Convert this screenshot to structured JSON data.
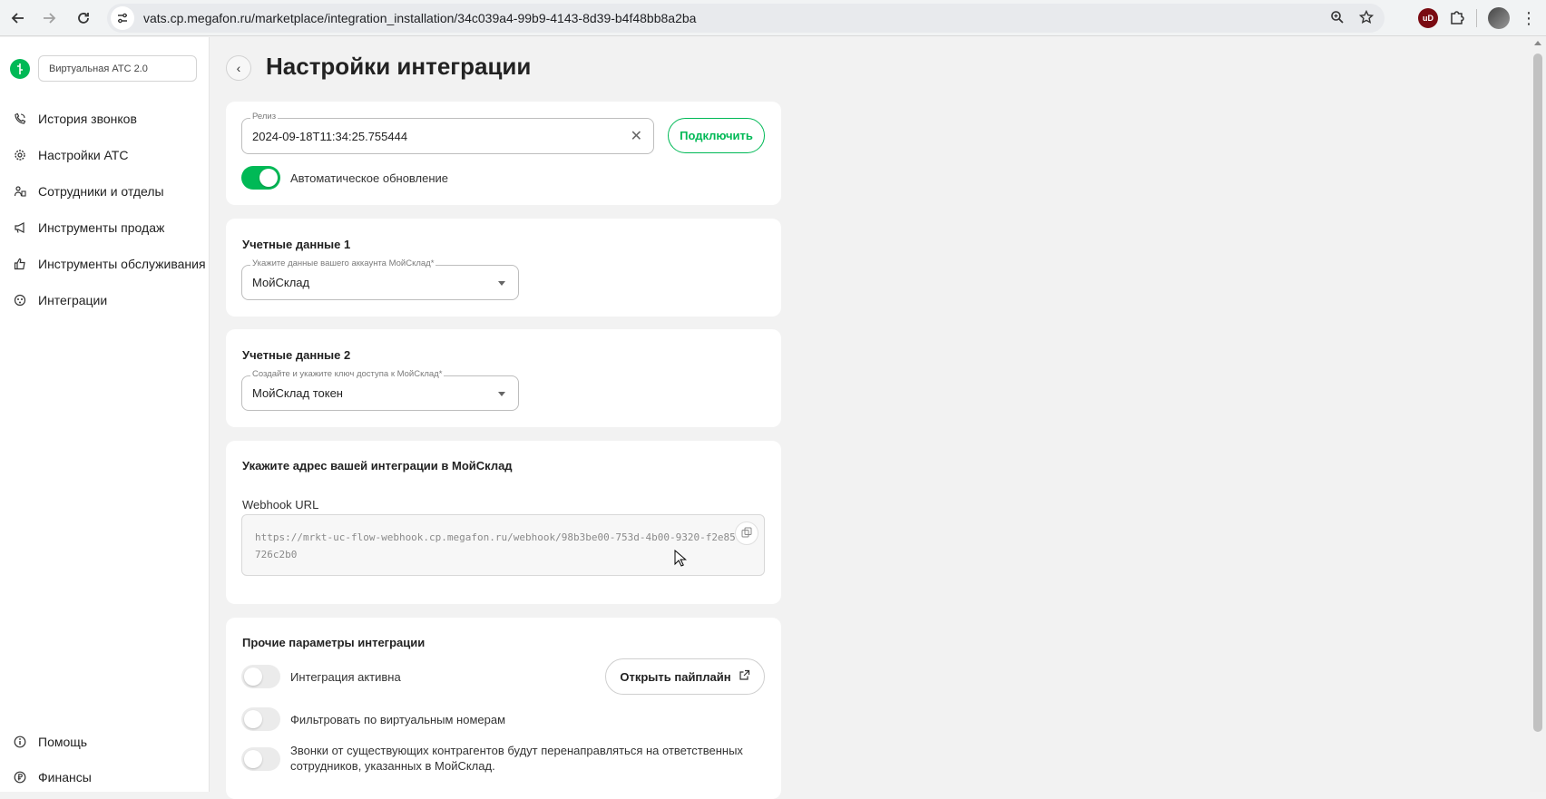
{
  "browser": {
    "url": "vats.cp.megafon.ru/marketplace/integration_installation/34c039a4-99b9-4143-8d39-b4f48bb8a2ba",
    "extension_badge": "uD"
  },
  "sidebar": {
    "product": "Виртуальная АТС 2.0",
    "items": [
      {
        "label": "История звонков",
        "icon": "phone-history-icon"
      },
      {
        "label": "Настройки АТС",
        "icon": "gear-icon"
      },
      {
        "label": "Сотрудники и отделы",
        "icon": "people-icon"
      },
      {
        "label": "Инструменты продаж",
        "icon": "megaphone-icon"
      },
      {
        "label": "Инструменты обслуживания",
        "icon": "thumbs-up-icon"
      },
      {
        "label": "Интеграции",
        "icon": "integrations-icon"
      }
    ],
    "bottom_items": [
      {
        "label": "Помощь",
        "icon": "info-icon"
      },
      {
        "label": "Финансы",
        "icon": "ruble-icon"
      }
    ]
  },
  "page": {
    "title": "Настройки интеграции"
  },
  "release_card": {
    "field_label": "Релиз",
    "field_value": "2024-09-18T11:34:25.755444",
    "connect_button": "Подключить",
    "auto_update_label": "Автоматическое обновление",
    "auto_update_on": true
  },
  "credentials1": {
    "title": "Учетные данные 1",
    "field_label": "Укажите данные вашего аккаунта МойСклад*",
    "field_value": "МойСклад"
  },
  "credentials2": {
    "title": "Учетные данные 2",
    "field_label": "Создайте и укажите ключ доступа к МойСклад*",
    "field_value": "МойСклад токен"
  },
  "webhook_card": {
    "title": "Укажите адрес вашей интеграции в МойСклад",
    "label": "Webhook URL",
    "url": "https://mrkt-uc-flow-webhook.cp.megafon.ru/webhook/98b3be00-753d-4b00-9320-f2e85726c2b0"
  },
  "other_card": {
    "title": "Прочие параметры интеграции",
    "open_pipeline_button": "Открыть пайплайн",
    "toggles": [
      {
        "label": "Интеграция активна",
        "on": false
      },
      {
        "label": "Фильтровать по виртуальным номерам",
        "on": false
      },
      {
        "label": "Звонки от существующих контрагентов будут перенаправляться на ответственных сотрудников, указанных в МойСклад.",
        "on": false
      }
    ]
  },
  "colors": {
    "accent": "#00b956",
    "background": "#f2f2f2",
    "card": "#ffffff"
  }
}
